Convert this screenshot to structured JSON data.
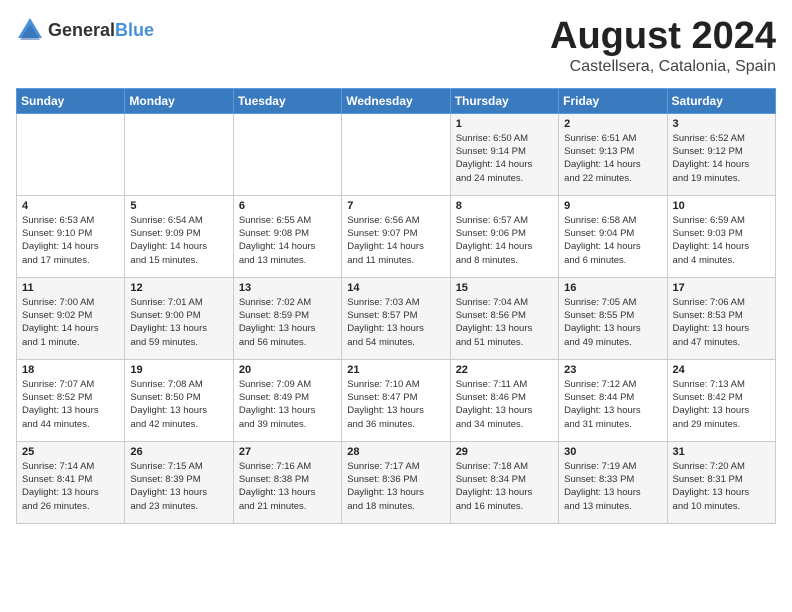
{
  "logo": {
    "general": "General",
    "blue": "Blue"
  },
  "title": {
    "month_year": "August 2024",
    "location": "Castellsera, Catalonia, Spain"
  },
  "header_days": [
    "Sunday",
    "Monday",
    "Tuesday",
    "Wednesday",
    "Thursday",
    "Friday",
    "Saturday"
  ],
  "weeks": [
    [
      {
        "day": "",
        "info": ""
      },
      {
        "day": "",
        "info": ""
      },
      {
        "day": "",
        "info": ""
      },
      {
        "day": "",
        "info": ""
      },
      {
        "day": "1",
        "info": "Sunrise: 6:50 AM\nSunset: 9:14 PM\nDaylight: 14 hours\nand 24 minutes."
      },
      {
        "day": "2",
        "info": "Sunrise: 6:51 AM\nSunset: 9:13 PM\nDaylight: 14 hours\nand 22 minutes."
      },
      {
        "day": "3",
        "info": "Sunrise: 6:52 AM\nSunset: 9:12 PM\nDaylight: 14 hours\nand 19 minutes."
      }
    ],
    [
      {
        "day": "4",
        "info": "Sunrise: 6:53 AM\nSunset: 9:10 PM\nDaylight: 14 hours\nand 17 minutes."
      },
      {
        "day": "5",
        "info": "Sunrise: 6:54 AM\nSunset: 9:09 PM\nDaylight: 14 hours\nand 15 minutes."
      },
      {
        "day": "6",
        "info": "Sunrise: 6:55 AM\nSunset: 9:08 PM\nDaylight: 14 hours\nand 13 minutes."
      },
      {
        "day": "7",
        "info": "Sunrise: 6:56 AM\nSunset: 9:07 PM\nDaylight: 14 hours\nand 11 minutes."
      },
      {
        "day": "8",
        "info": "Sunrise: 6:57 AM\nSunset: 9:06 PM\nDaylight: 14 hours\nand 8 minutes."
      },
      {
        "day": "9",
        "info": "Sunrise: 6:58 AM\nSunset: 9:04 PM\nDaylight: 14 hours\nand 6 minutes."
      },
      {
        "day": "10",
        "info": "Sunrise: 6:59 AM\nSunset: 9:03 PM\nDaylight: 14 hours\nand 4 minutes."
      }
    ],
    [
      {
        "day": "11",
        "info": "Sunrise: 7:00 AM\nSunset: 9:02 PM\nDaylight: 14 hours\nand 1 minute."
      },
      {
        "day": "12",
        "info": "Sunrise: 7:01 AM\nSunset: 9:00 PM\nDaylight: 13 hours\nand 59 minutes."
      },
      {
        "day": "13",
        "info": "Sunrise: 7:02 AM\nSunset: 8:59 PM\nDaylight: 13 hours\nand 56 minutes."
      },
      {
        "day": "14",
        "info": "Sunrise: 7:03 AM\nSunset: 8:57 PM\nDaylight: 13 hours\nand 54 minutes."
      },
      {
        "day": "15",
        "info": "Sunrise: 7:04 AM\nSunset: 8:56 PM\nDaylight: 13 hours\nand 51 minutes."
      },
      {
        "day": "16",
        "info": "Sunrise: 7:05 AM\nSunset: 8:55 PM\nDaylight: 13 hours\nand 49 minutes."
      },
      {
        "day": "17",
        "info": "Sunrise: 7:06 AM\nSunset: 8:53 PM\nDaylight: 13 hours\nand 47 minutes."
      }
    ],
    [
      {
        "day": "18",
        "info": "Sunrise: 7:07 AM\nSunset: 8:52 PM\nDaylight: 13 hours\nand 44 minutes."
      },
      {
        "day": "19",
        "info": "Sunrise: 7:08 AM\nSunset: 8:50 PM\nDaylight: 13 hours\nand 42 minutes."
      },
      {
        "day": "20",
        "info": "Sunrise: 7:09 AM\nSunset: 8:49 PM\nDaylight: 13 hours\nand 39 minutes."
      },
      {
        "day": "21",
        "info": "Sunrise: 7:10 AM\nSunset: 8:47 PM\nDaylight: 13 hours\nand 36 minutes."
      },
      {
        "day": "22",
        "info": "Sunrise: 7:11 AM\nSunset: 8:46 PM\nDaylight: 13 hours\nand 34 minutes."
      },
      {
        "day": "23",
        "info": "Sunrise: 7:12 AM\nSunset: 8:44 PM\nDaylight: 13 hours\nand 31 minutes."
      },
      {
        "day": "24",
        "info": "Sunrise: 7:13 AM\nSunset: 8:42 PM\nDaylight: 13 hours\nand 29 minutes."
      }
    ],
    [
      {
        "day": "25",
        "info": "Sunrise: 7:14 AM\nSunset: 8:41 PM\nDaylight: 13 hours\nand 26 minutes."
      },
      {
        "day": "26",
        "info": "Sunrise: 7:15 AM\nSunset: 8:39 PM\nDaylight: 13 hours\nand 23 minutes."
      },
      {
        "day": "27",
        "info": "Sunrise: 7:16 AM\nSunset: 8:38 PM\nDaylight: 13 hours\nand 21 minutes."
      },
      {
        "day": "28",
        "info": "Sunrise: 7:17 AM\nSunset: 8:36 PM\nDaylight: 13 hours\nand 18 minutes."
      },
      {
        "day": "29",
        "info": "Sunrise: 7:18 AM\nSunset: 8:34 PM\nDaylight: 13 hours\nand 16 minutes."
      },
      {
        "day": "30",
        "info": "Sunrise: 7:19 AM\nSunset: 8:33 PM\nDaylight: 13 hours\nand 13 minutes."
      },
      {
        "day": "31",
        "info": "Sunrise: 7:20 AM\nSunset: 8:31 PM\nDaylight: 13 hours\nand 10 minutes."
      }
    ]
  ]
}
